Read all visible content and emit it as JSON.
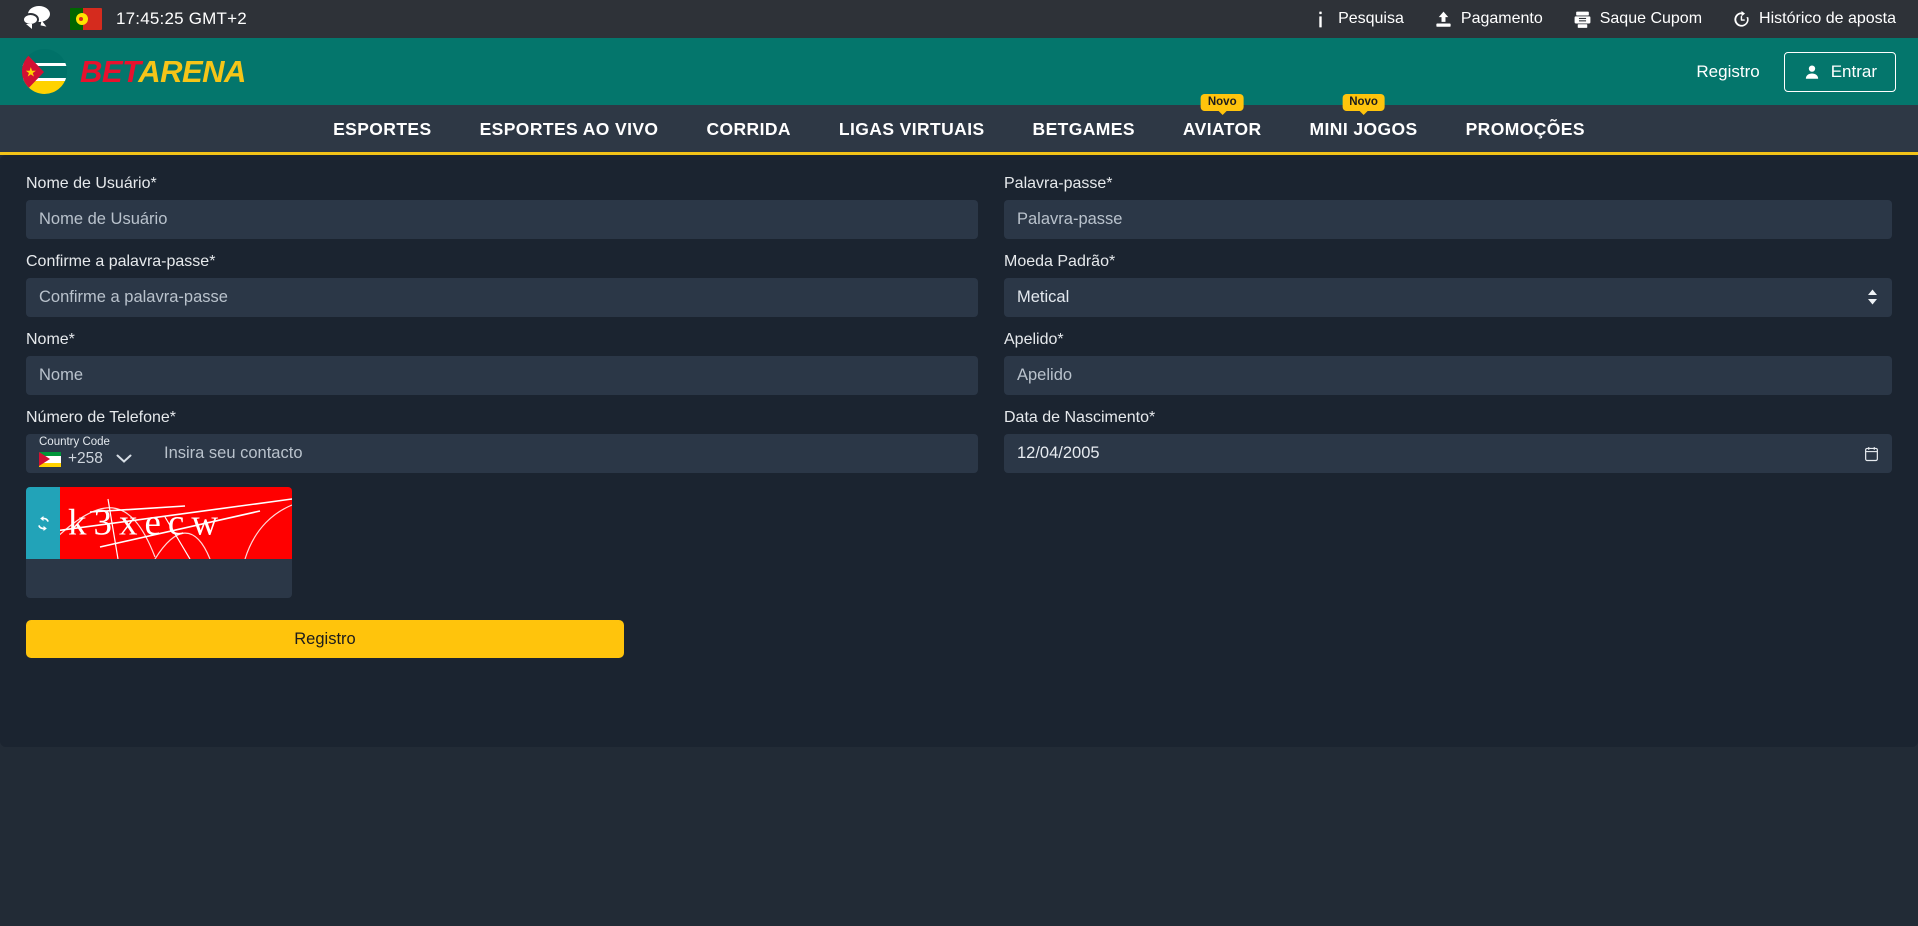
{
  "topbar": {
    "chat_icon": "chat-bubbles-icon",
    "language_flag": "portugal-flag-icon",
    "clock": "17:45:25 GMT+2",
    "links": [
      {
        "label": "Pesquisa",
        "icon": "info-icon"
      },
      {
        "label": "Pagamento",
        "icon": "upload-payment-icon"
      },
      {
        "label": "Saque Cupom",
        "icon": "ticket-printer-icon"
      },
      {
        "label": "Histórico de aposta",
        "icon": "history-clock-icon"
      }
    ]
  },
  "header": {
    "flag_icon": "mozambique-flag-icon",
    "logo_bet": "BET",
    "logo_arena": "ARENA",
    "register_link": "Registro",
    "login_button": "Entrar",
    "login_icon": "user-icon",
    "brand_color": "#04766c",
    "logo_bet_color": "#e8112d",
    "logo_arena_color": "#f5c518"
  },
  "nav": {
    "accent_color": "#f3c318",
    "items": [
      {
        "label": "ESPORTES",
        "badge": null
      },
      {
        "label": "ESPORTES AO VIVO",
        "badge": null
      },
      {
        "label": "CORRIDA",
        "badge": null
      },
      {
        "label": "LIGAS VIRTUAIS",
        "badge": null
      },
      {
        "label": "BETGAMES",
        "badge": null
      },
      {
        "label": "AVIATOR",
        "badge": "Novo"
      },
      {
        "label": "MINI JOGOS",
        "badge": "Novo"
      },
      {
        "label": "PROMOÇÕES",
        "badge": null
      }
    ]
  },
  "form": {
    "username": {
      "label": "Nome de Usuário*",
      "placeholder": "Nome de Usuário",
      "value": ""
    },
    "password": {
      "label": "Palavra-passe*",
      "placeholder": "Palavra-passe",
      "value": ""
    },
    "confirm_password": {
      "label": "Confirme a palavra-passe*",
      "placeholder": "Confirme a palavra-passe",
      "value": ""
    },
    "currency": {
      "label": "Moeda Padrão*",
      "selected": "Metical",
      "options": [
        "Metical"
      ]
    },
    "name": {
      "label": "Nome*",
      "placeholder": "Nome",
      "value": ""
    },
    "nickname": {
      "label": "Apelido*",
      "placeholder": "Apelido",
      "value": ""
    },
    "phone": {
      "label": "Número de Telefone*",
      "country_code_label": "Country Code",
      "country_code": "+258",
      "country_flag": "mozambique-flag-icon",
      "placeholder": "Insira seu contacto",
      "value": ""
    },
    "birthdate": {
      "label": "Data de Nascimento*",
      "value": "12/04/2005"
    },
    "captcha": {
      "text": "k3xecw",
      "refresh_icon": "refresh-icon",
      "input_placeholder": "",
      "input_value": "",
      "bg_color": "#ff0000",
      "refresh_bg_color": "#22a3b8"
    },
    "submit_label": "Registro",
    "submit_color": "#ffc40c"
  }
}
